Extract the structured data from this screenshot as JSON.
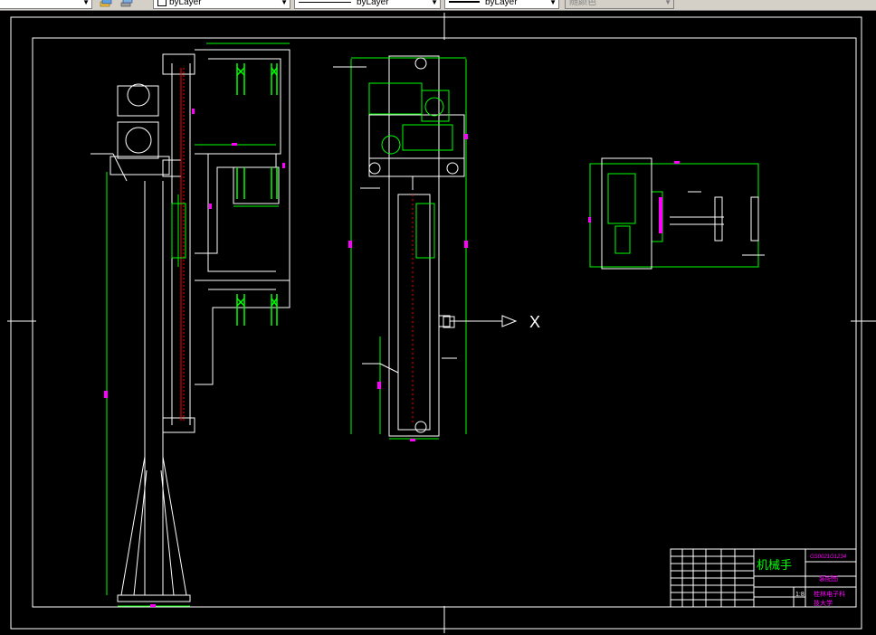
{
  "toolbar": {
    "layer_arrow": "▼",
    "color_combo": "byLayer",
    "linetype_combo": "byLayer",
    "lineweight_combo": "byLayer",
    "plotstyle_combo": "随颜色"
  },
  "drawing": {
    "x_marker": "X",
    "title_block": {
      "name": "机械手",
      "code": "GS0021G1234",
      "material": "装配图",
      "company": "桂林电子科",
      "school": "技大学",
      "scale": "1:8"
    }
  },
  "colors": {
    "background": "#000000",
    "frame": "#ffffff",
    "outline": "#00ff00",
    "dimension": "#00ff00",
    "dim_text": "#ff00ff",
    "hidden": "#ff0000",
    "annotation": "#ffffff"
  }
}
